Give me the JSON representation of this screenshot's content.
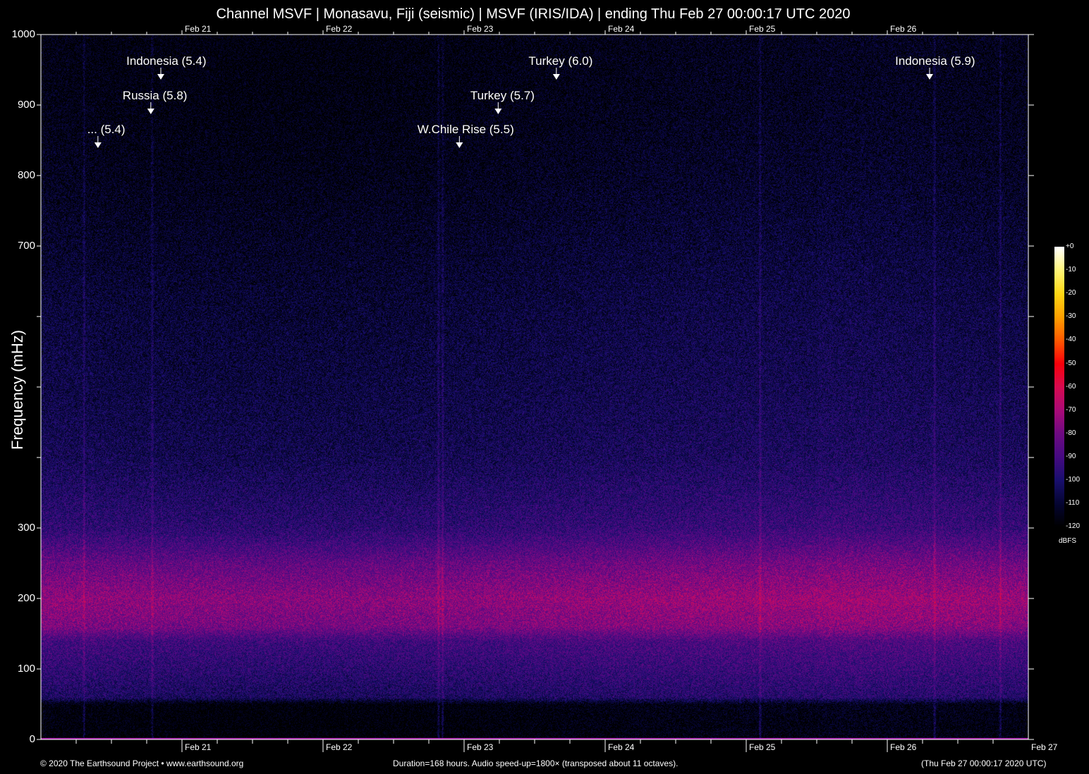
{
  "title": "Channel MSVF | Monasavu, Fiji (seismic) | MSVF (IRIS/IDA) | ending Thu Feb 27 00:00:17 UTC 2020",
  "footer": {
    "left": "© 2020 The Earthsound Project • www.earthsound.org",
    "center": "Duration=168 hours. Audio speed-up=1800× (transposed about 11 octaves).",
    "right": "(Thu Feb 27 00:00:17 2020 UTC)"
  },
  "chart_data": {
    "type": "heatmap",
    "title": "Channel MSVF | Monasavu, Fiji (seismic) | MSVF (IRIS/IDA) | ending Thu Feb 27 00:00:17 UTC 2020",
    "xlabel": "",
    "ylabel": "Frequency (mHz)",
    "xlim_hours": [
      0,
      168
    ],
    "ylim": [
      0,
      1000
    ],
    "y_ticks": [
      0,
      100,
      200,
      300,
      400,
      500,
      600,
      700,
      800,
      900,
      1000
    ],
    "y_tick_labels": [
      "0",
      "100",
      "200",
      "300",
      "",
      "",
      "",
      "700",
      "800",
      "900",
      "1000"
    ],
    "x_tick_hours": [
      24,
      48,
      72,
      96,
      120,
      144
    ],
    "x_tick_labels_top": [
      "Feb 21",
      "Feb 22",
      "Feb 23",
      "Feb 24",
      "Feb 25",
      "Feb 26"
    ],
    "x_tick_labels_bottom": [
      "Feb 21",
      "Feb 22",
      "Feb 23",
      "Feb 24",
      "Feb 25",
      "Feb 26",
      "Feb 27"
    ],
    "colorbar": {
      "label": "dBFS",
      "range": [
        -120,
        0
      ],
      "ticks": [
        "+0",
        "-10",
        "-20",
        "-30",
        "-40",
        "-50",
        "-60",
        "-70",
        "-80",
        "-90",
        "-100",
        "-110",
        "-120"
      ]
    },
    "noise_profile": {
      "frequency_mHz": [
        0,
        50,
        60,
        100,
        140,
        160,
        200,
        250,
        300,
        400,
        500,
        600,
        700,
        800,
        900,
        1000
      ],
      "dBFS": [
        -120,
        -118,
        -100,
        -95,
        -90,
        -78,
        -74,
        -82,
        -95,
        -103,
        -106,
        -108,
        -111,
        -114,
        -116,
        -117
      ]
    },
    "events": [
      {
        "label": "Indonesia (5.4)",
        "hour": 20.4,
        "row": 1
      },
      {
        "label": "Russia (5.8)",
        "hour": 18.7,
        "row": 2
      },
      {
        "label": "... (5.4)",
        "hour": 9.7,
        "row": 3
      },
      {
        "label": "W.Chile Rise (5.5)",
        "hour": 71.2,
        "row": 3
      },
      {
        "label": "Turkey (5.7)",
        "hour": 77.8,
        "row": 2
      },
      {
        "label": "Turkey (6.0)",
        "hour": 87.7,
        "row": 1
      },
      {
        "label": "Indonesia (5.9)",
        "hour": 151.2,
        "row": 1
      }
    ],
    "vertical_streaks_hours": [
      7.3,
      18.9,
      67.6,
      68.3,
      122.3,
      152.0,
      163.2
    ]
  }
}
